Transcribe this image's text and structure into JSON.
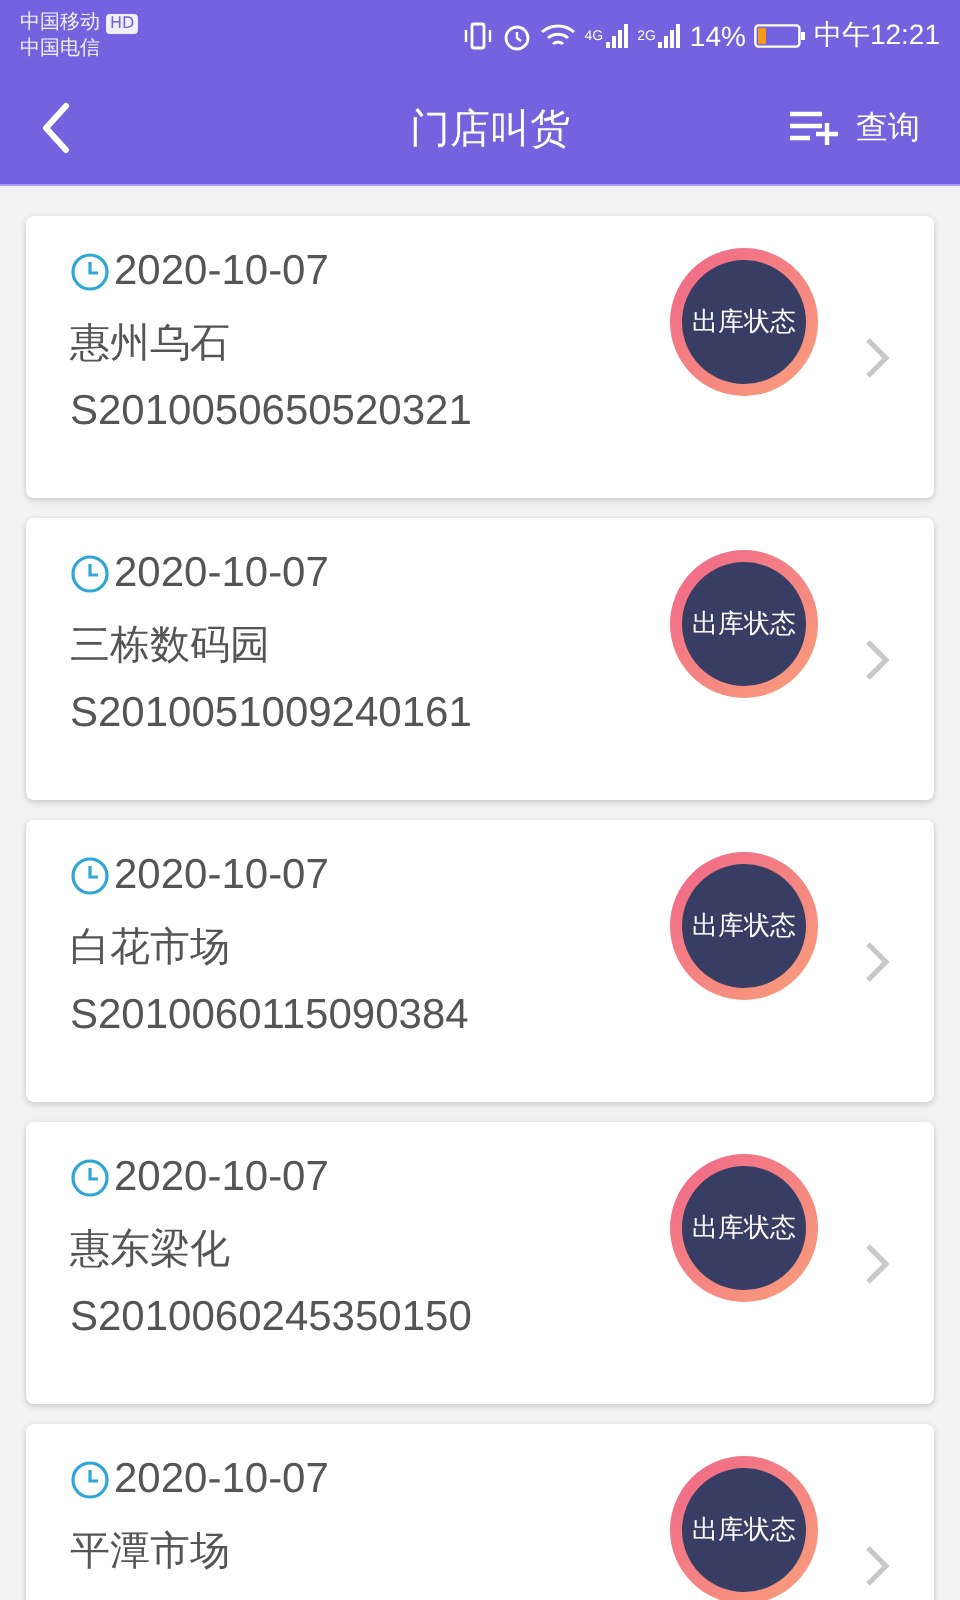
{
  "status_bar": {
    "carriers": [
      "中国移动",
      "中国电信"
    ],
    "hd_badge": "HD",
    "network_1": "4G",
    "network_2": "2G",
    "battery": "14%",
    "time": "中午12:21"
  },
  "header": {
    "title": "门店叫货",
    "query_label": "查询"
  },
  "orders": [
    {
      "date": "2020-10-07",
      "store": "惠州乌石",
      "order_no": "S2010050650520321",
      "status": "出库状态"
    },
    {
      "date": "2020-10-07",
      "store": "三栋数码园",
      "order_no": "S2010051009240161",
      "status": "出库状态"
    },
    {
      "date": "2020-10-07",
      "store": "白花市场",
      "order_no": "S2010060115090384",
      "status": "出库状态"
    },
    {
      "date": "2020-10-07",
      "store": "惠东梁化",
      "order_no": "S2010060245350150",
      "status": "出库状态"
    },
    {
      "date": "2020-10-07",
      "store": "平潭市场",
      "status": "出库状态"
    }
  ]
}
